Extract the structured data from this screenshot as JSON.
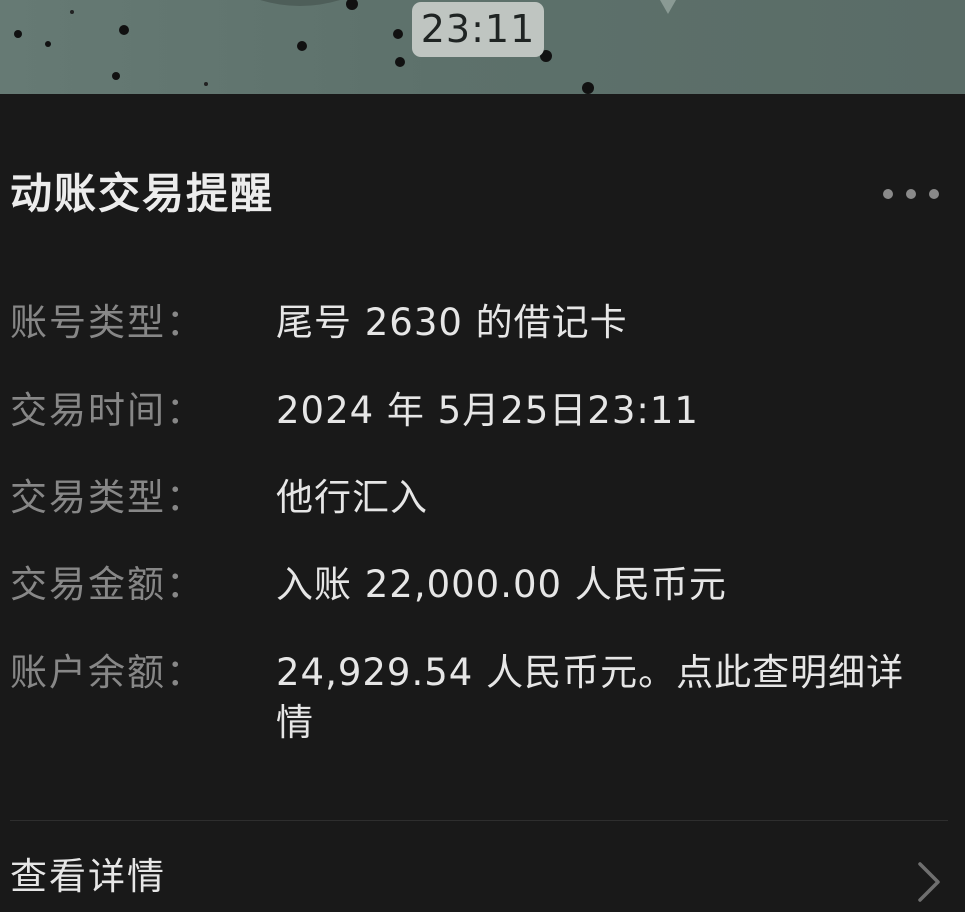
{
  "status_bar": {
    "time": "23:11"
  },
  "card": {
    "title": "动账交易提醒",
    "more_icon": "more-horizontal-icon",
    "rows": [
      {
        "label": "账号类型：",
        "value": "尾号 2630 的借记卡"
      },
      {
        "label": "交易时间：",
        "value": "2024 年 5月25日23:11"
      },
      {
        "label": "交易类型：",
        "value": "他行汇入"
      },
      {
        "label": "交易金额：",
        "value": "入账 22,000.00 人民币元"
      },
      {
        "label": "账户余额：",
        "value": "24,929.54 人民币元。点此查明细详情"
      }
    ],
    "detail_link": {
      "label": "查看详情",
      "icon": "chevron-right-icon"
    }
  },
  "colors": {
    "background": "#191919",
    "wallpaper": "#5f736d",
    "title": "#ececec",
    "label": "#878787",
    "value": "#e6e6e6"
  }
}
